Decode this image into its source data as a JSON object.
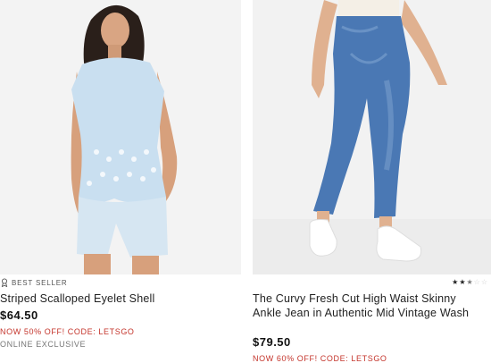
{
  "products": [
    {
      "badge": "BEST SELLER",
      "name": "Striped Scalloped Eyelet Shell",
      "price": "$64.50",
      "promo": "NOW 50% OFF! CODE: LETSGO",
      "tag": "ONLINE EXCLUSIVE",
      "badge_icon": "ribbon-icon"
    },
    {
      "name": "The Curvy Fresh Cut High Waist Skinny Ankle Jean in Authentic Mid Vintage Wash",
      "price": "$79.50",
      "promo": "NOW 60% OFF! CODE: LETSGO",
      "rating": 2.5,
      "rating_max": 5
    }
  ],
  "colors": {
    "promo": "#c4342b",
    "star_filled": "#222222",
    "star_empty": "#cccccc"
  }
}
